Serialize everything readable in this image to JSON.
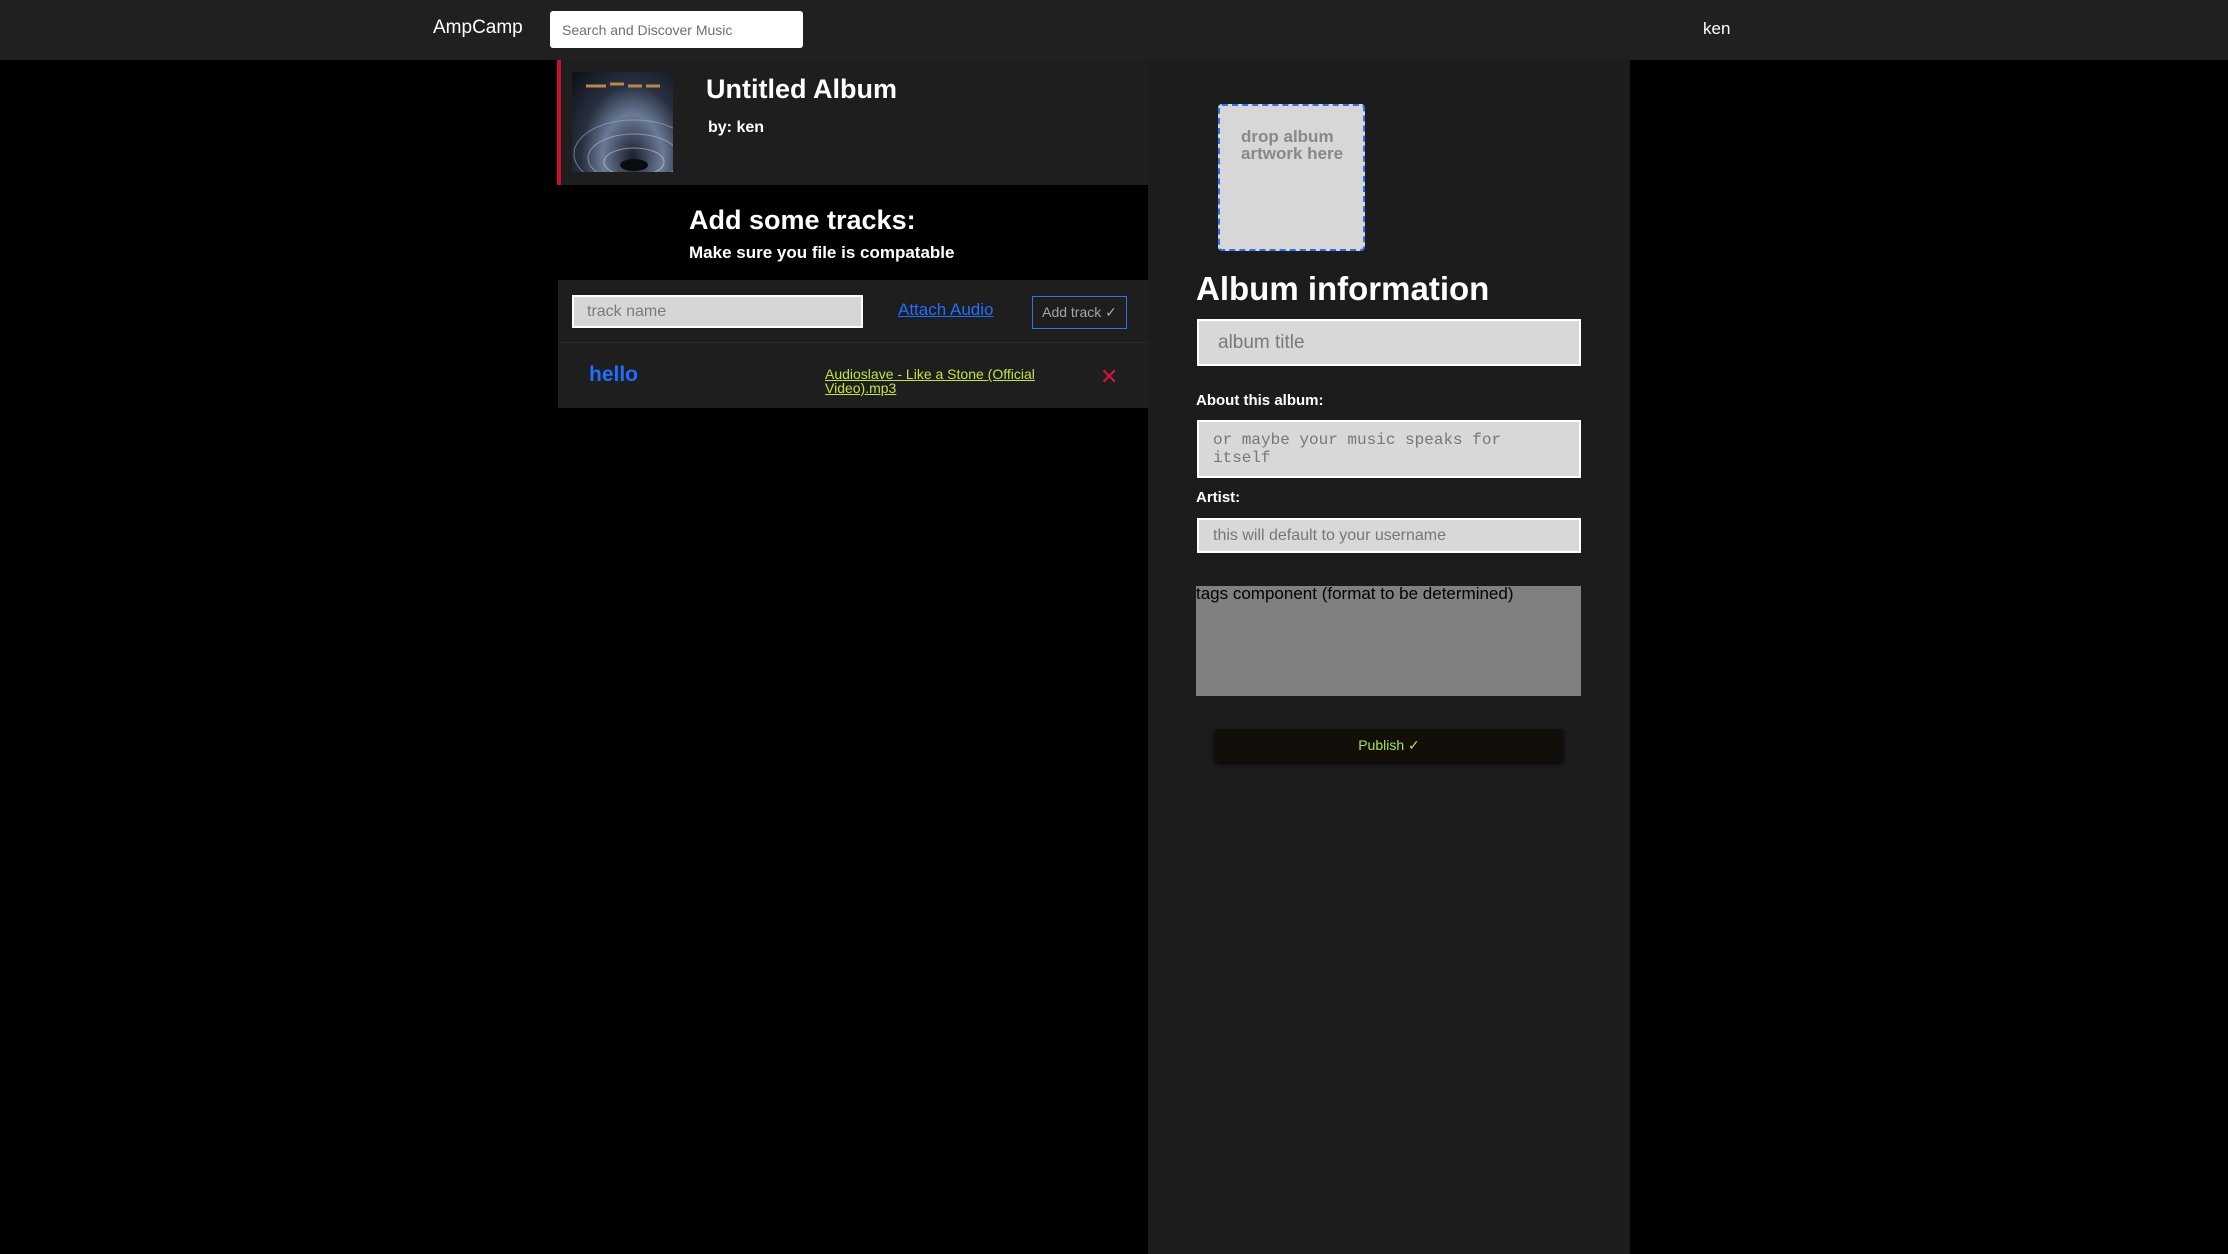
{
  "nav": {
    "brand": "AmpCamp",
    "search_placeholder": "Search and Discover Music",
    "username": "ken"
  },
  "album": {
    "title": "Untitled Album",
    "byline": "by: ken"
  },
  "tracks": {
    "heading": "Add some tracks:",
    "subheading": "Make sure you file is compatable",
    "name_placeholder": "track name",
    "attach_label": "Attach Audio",
    "add_label": "Add track ✓",
    "items": [
      {
        "name": "hello",
        "file": "Audioslave - Like a Stone (Official Video).mp3",
        "remove_icon": "✕"
      }
    ]
  },
  "info": {
    "dropzone_text": "drop album artwork here",
    "heading": "Album information",
    "title_placeholder": "album title",
    "about_label": "About this album:",
    "about_placeholder": "or maybe your music speaks for itself",
    "artist_label": "Artist:",
    "artist_placeholder": "this will default to your username",
    "tags_text": "tags component (format to be determined)",
    "publish_label": "Publish ✓"
  },
  "colors": {
    "accent_red": "#c8102e",
    "link_blue": "#1e6fff",
    "file_green": "#c0e24a",
    "publish_green": "#a8e24a"
  }
}
